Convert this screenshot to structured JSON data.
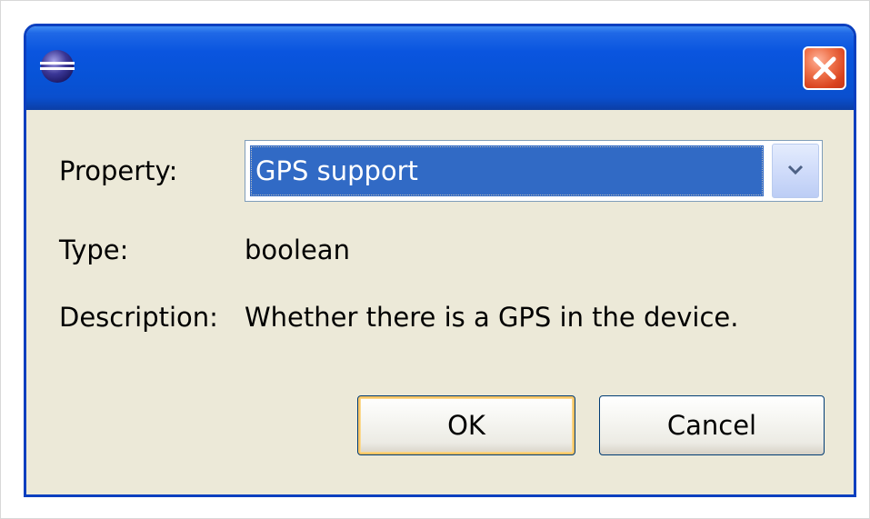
{
  "window": {
    "title": "",
    "icons": {
      "app": "eclipse-icon",
      "close": "close-icon"
    },
    "colors": {
      "titlebar": "#0753d7",
      "close_button": "#d9421d",
      "client_bg": "#ece9d8",
      "selection": "#316ac5"
    }
  },
  "form": {
    "property_label": "Property:",
    "property_value": "GPS support",
    "property_dropdown_icon": "chevron-down-icon",
    "type_label": "Type:",
    "type_value": "boolean",
    "description_label": "Description:",
    "description_value": "Whether there is a GPS in the device."
  },
  "buttons": {
    "ok_label": "OK",
    "cancel_label": "Cancel"
  }
}
